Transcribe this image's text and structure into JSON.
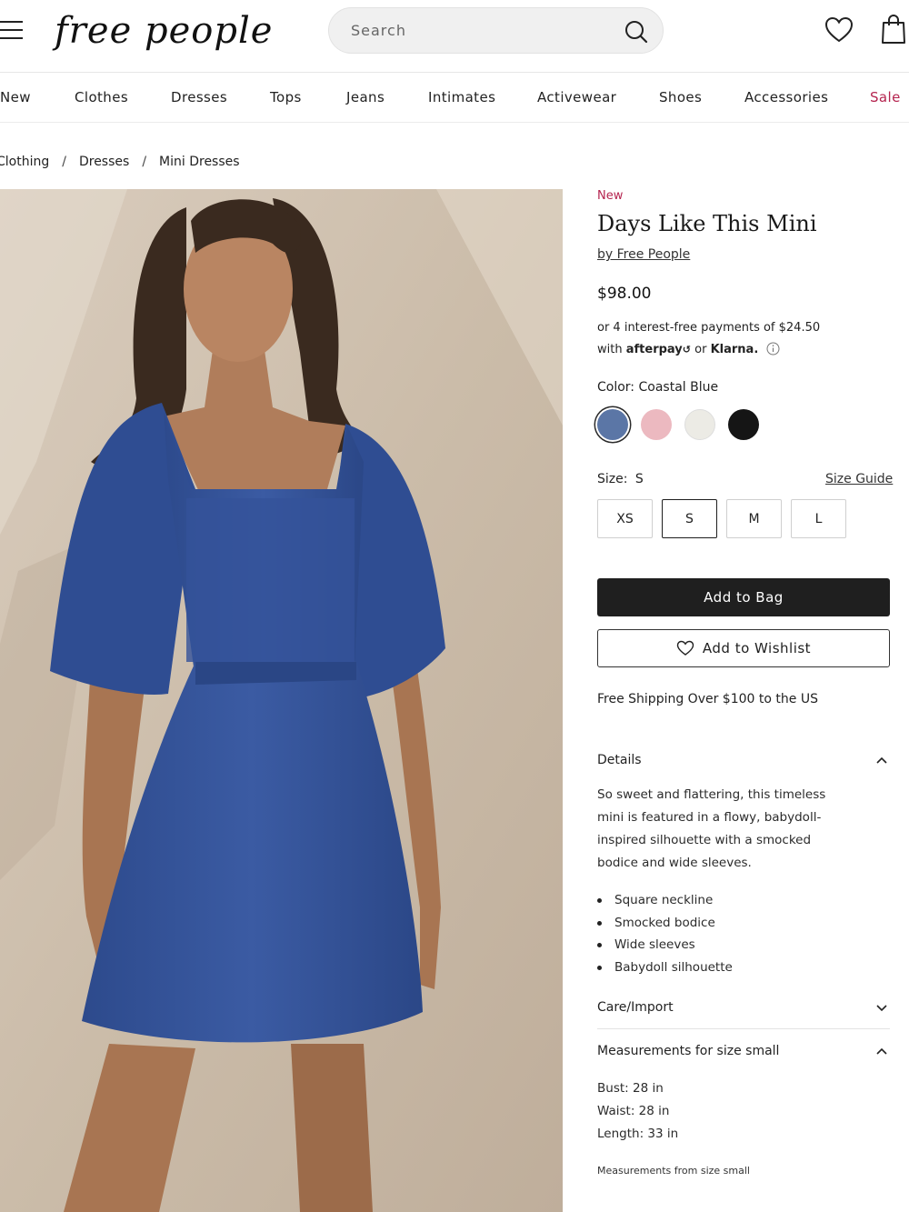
{
  "header": {
    "logo_text": "free people",
    "search_placeholder": "Search"
  },
  "nav": {
    "items": [
      "New",
      "Clothes",
      "Dresses",
      "Tops",
      "Jeans",
      "Intimates",
      "Activewear",
      "Shoes",
      "Accessories",
      "Sale"
    ]
  },
  "breadcrumb": [
    "Clothing",
    "Dresses",
    "Mini Dresses"
  ],
  "product": {
    "tag": "New",
    "title": "Days Like This Mini",
    "brand": "by Free People",
    "price": "$98.00",
    "installment_line1": "or 4 interest-free payments of $24.50",
    "installment_with": "with",
    "afterpay": "afterpay",
    "or": "or",
    "klarna": "Klarna.",
    "color_label": "Color:",
    "color_value": "Coastal Blue",
    "swatches": [
      {
        "name": "Coastal Blue",
        "hex": "#5b76a6",
        "selected": true
      },
      {
        "name": "Pink",
        "hex": "#ecb9c0",
        "selected": false
      },
      {
        "name": "Ivory",
        "hex": "#ecebe5",
        "selected": false
      },
      {
        "name": "Black",
        "hex": "#151515",
        "selected": false
      }
    ],
    "size_label": "Size:",
    "size_value": "S",
    "size_guide": "Size Guide",
    "sizes": [
      "XS",
      "S",
      "M",
      "L"
    ],
    "selected_size": "S",
    "add_to_bag": "Add to Bag",
    "add_to_wishlist": "Add to Wishlist",
    "shipping": "Free Shipping Over $100 to the US"
  },
  "details": {
    "heading": "Details",
    "description": "So sweet and flattering, this timeless mini is featured in a flowy, babydoll-inspired silhouette with a smocked bodice and wide sleeves.",
    "bullets": [
      "Square neckline",
      "Smocked bodice",
      "Wide sleeves",
      "Babydoll silhouette"
    ]
  },
  "care": {
    "heading": "Care/Import"
  },
  "measurements": {
    "heading": "Measurements for size small",
    "bust": "Bust: 28 in",
    "waist": "Waist: 28 in",
    "length": "Length: 33 in",
    "note": "Measurements from size small"
  },
  "colors": {
    "accent": "#b5244f",
    "button": "#1f1f1f"
  }
}
